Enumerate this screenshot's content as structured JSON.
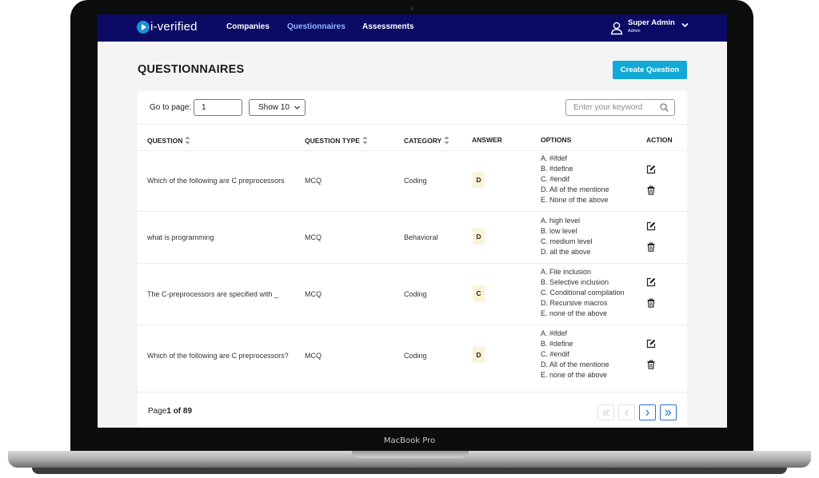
{
  "device": {
    "label": "MacBook Pro"
  },
  "nav": {
    "logo_text": "i-verified",
    "links": [
      {
        "label": "Companies",
        "active": false
      },
      {
        "label": "Questionnaires",
        "active": true
      },
      {
        "label": "Assessments",
        "active": false
      }
    ],
    "user": {
      "name": "Super Admin",
      "role": "Admin"
    }
  },
  "page": {
    "title": "QUESTIONNAIRES",
    "create_label": "Create Question"
  },
  "toolbar": {
    "goto_label": "Go to page:",
    "goto_value": "1",
    "show_label": "Show 10",
    "search_placeholder": "Enter your keyword"
  },
  "table": {
    "headers": {
      "question": "QUESTION",
      "type": "QUESTION TYPE",
      "category": "CATEGORY",
      "answer": "ANSWER",
      "options": "OPTIONS",
      "action": "ACTION"
    },
    "rows": [
      {
        "question": "Which of the following are C preprocessors",
        "type": "MCQ",
        "category": "Coding",
        "answer": "D",
        "options": [
          "A. #ifdef",
          "B. #define",
          "C. #endif",
          "D. All of the mentione",
          "E. None of the above"
        ]
      },
      {
        "question": "what is programming",
        "type": "MCQ",
        "category": "Behavioral",
        "answer": "D",
        "options": [
          "A. high level",
          "B. low level",
          "C. medium level",
          "D. all the above"
        ]
      },
      {
        "question": "The C-preprocessors are specified with _",
        "type": "MCQ",
        "category": "Coding",
        "answer": "C",
        "options": [
          "A. File inclusion",
          "B. Selective inclusion",
          "C. Conditional compilation",
          "D. Recursive macros",
          "E. none of the above"
        ]
      },
      {
        "question": "Which of the following are C preprocessors?",
        "type": "MCQ",
        "category": "Coding",
        "answer": "D",
        "options": [
          "A. #ifdef",
          "B. #define",
          "C. #endif",
          "D. All of the mentione",
          "E. none of the above"
        ]
      }
    ]
  },
  "pagination": {
    "prefix": "Page",
    "current": "1 of 89"
  },
  "colors": {
    "nav_bg": "#0b0b66",
    "accent": "#13a9d6",
    "answer_bg": "#fbf3d8",
    "pager_active": "#2b6fd3"
  }
}
